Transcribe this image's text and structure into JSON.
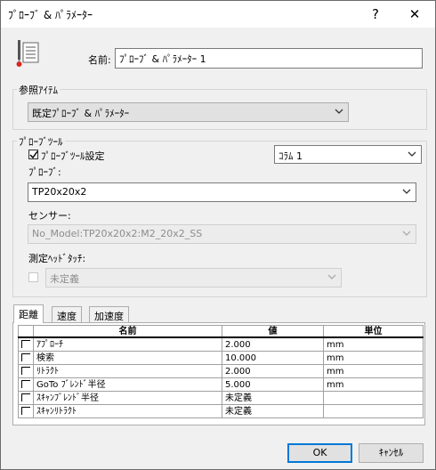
{
  "window": {
    "title": "ﾌﾟﾛｰﾌﾞ & ﾊﾟﾗﾒｰﾀｰ",
    "help_label": "?",
    "close_label": "✕"
  },
  "icons": {
    "app": "probe-list-icon",
    "dropdown": "chevron-down-icon",
    "check": "check-icon"
  },
  "name": {
    "label": "名前:",
    "value": "ﾌﾟﾛｰﾌﾞ & ﾊﾟﾗﾒｰﾀｰ 1"
  },
  "reference": {
    "group_title": "参照ｱｲﾃﾑ",
    "selected": "既定ﾌﾟﾛｰﾌﾞ & ﾊﾟﾗﾒｰﾀｰ"
  },
  "probe_tool": {
    "group_title": "ﾌﾟﾛｰﾌﾞﾂｰﾙ",
    "settings_checkbox_label": "ﾌﾟﾛｰﾌﾞﾂｰﾙ設定",
    "settings_checked": true,
    "column_selected": "ｺﾗﾑ 1",
    "probe_label": "ﾌﾟﾛｰﾌﾞ:",
    "probe_selected": "TP20x20x2",
    "sensor_label": "センサー:",
    "sensor_selected": "No_Model:TP20x20x2:M2_20x2_SS",
    "head_touch_label": "測定ﾍｯﾄﾞﾀｯﾁ:",
    "head_touch_selected": "未定義"
  },
  "tabs": [
    {
      "label": "距離"
    },
    {
      "label": "速度"
    },
    {
      "label": "加速度"
    }
  ],
  "table": {
    "headers": [
      "名前",
      "値",
      "単位"
    ],
    "rows": [
      {
        "name": "ｱﾌﾟﾛｰﾁ",
        "value": "2.000",
        "unit": "mm"
      },
      {
        "name": "検索",
        "value": "10.000",
        "unit": "mm"
      },
      {
        "name": "ﾘﾄﾗｸﾄ",
        "value": "2.000",
        "unit": "mm"
      },
      {
        "name": "GoTo ﾌﾞﾚﾝﾄﾞ半径",
        "value": "5.000",
        "unit": "mm"
      },
      {
        "name": "ｽｷｬﾝﾌﾞﾚﾝﾄﾞ半径",
        "value": "未定義",
        "unit": ""
      },
      {
        "name": "ｽｷｬﾝﾘﾄﾗｸﾄ",
        "value": "未定義",
        "unit": ""
      }
    ]
  },
  "buttons": {
    "ok": "OK",
    "cancel": "ｷｬﾝｾﾙ"
  }
}
